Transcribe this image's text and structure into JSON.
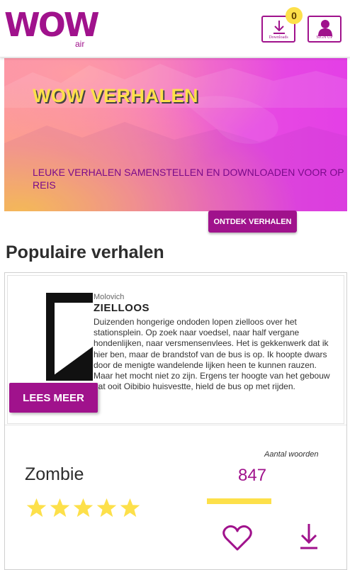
{
  "header": {
    "logo": {
      "main": "WOW",
      "sub": "air"
    },
    "downloads_label": "Downloads",
    "downloads_count": "0",
    "signup_label": "SIGN UP"
  },
  "hero": {
    "title": "WOW VERHALEN",
    "subtitle": "LEUKE VERHALEN SAMENSTELLEN EN DOWNLOADEN VOOR OP REIS",
    "cta_label": "ONTDEK VERHALEN"
  },
  "section": {
    "title": "Populaire verhalen"
  },
  "story": {
    "cover": {
      "author": "Molovich",
      "title": "ZIELLOOS",
      "excerpt": "Duizenden hongerige ondoden lopen zielloos over het stationsplein. Op zoek naar voedsel, naar half vergane hondenlijken, naar versmensenvlees. Het is gekkenwerk dat ik hier ben, maar de brandstof van de bus is op. Ik hoopte dwars door de menigte wandelende lijken heen te kunnen rauzen. Maar het mocht niet zo zijn. Ergens ter hoogte van het gebouw dat ooit Oibibio huisvestte, hield de bus op met rijden."
    },
    "read_more_label": "LEES MEER",
    "word_count_label": "Aantal woorden",
    "word_count": "847",
    "genre": "Zombie",
    "rating": 5,
    "rating_max": 5
  },
  "colors": {
    "brand": "#a0128c",
    "accent_yellow": "#fde04a",
    "text_dark": "#2d2d2d"
  },
  "icons": [
    "download-icon",
    "user-icon",
    "star-icon",
    "heart-icon"
  ]
}
